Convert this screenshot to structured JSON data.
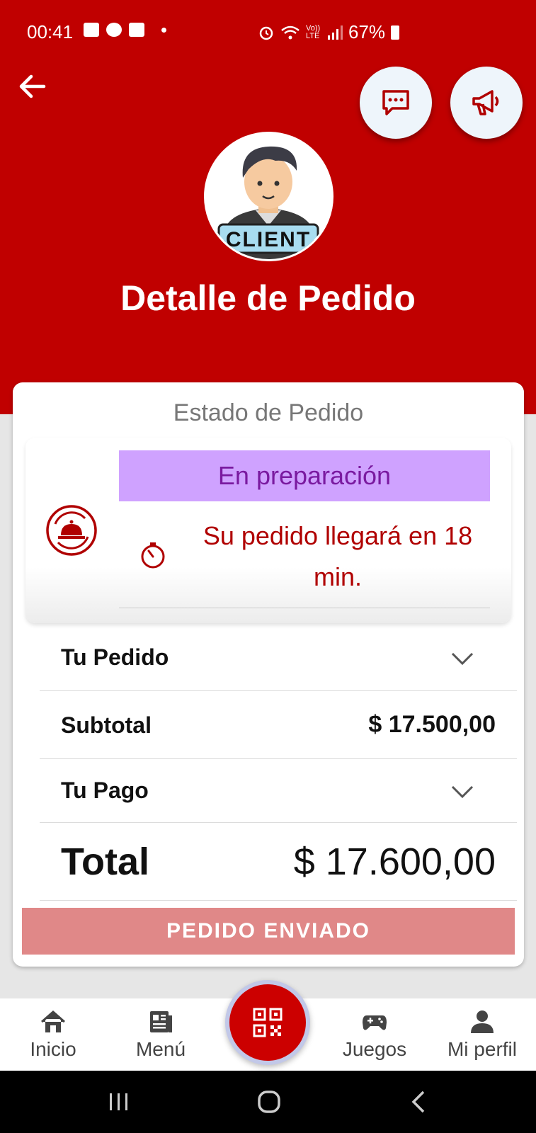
{
  "status_bar": {
    "time": "00:41",
    "battery": "67%",
    "signal_label": "Vo)) LTE"
  },
  "header": {
    "title": "Detalle de Pedido",
    "avatar_label": "CLIENT"
  },
  "status_section": {
    "label": "Estado de Pedido",
    "state": "En preparación",
    "eta_text": "Su pedido llegará en 18 min."
  },
  "summary": {
    "order_label": "Tu Pedido",
    "subtotal_label": "Subtotal",
    "subtotal_value": "$ 17.500,00",
    "payment_label": "Tu Pago",
    "total_label": "Total",
    "total_value": "$ 17.600,00"
  },
  "action": {
    "button_label": "PEDIDO ENVIADO"
  },
  "bottom_nav": {
    "items": [
      {
        "label": "Inicio",
        "icon": "home-icon"
      },
      {
        "label": "Menú",
        "icon": "menu-newspaper-icon"
      },
      {
        "label": "",
        "icon": "qr-code-icon"
      },
      {
        "label": "Juegos",
        "icon": "gamepad-icon"
      },
      {
        "label": "Mi perfil",
        "icon": "person-icon"
      }
    ]
  },
  "colors": {
    "brand_red": "#c00000",
    "status_pill_bg": "#cfa2ff",
    "status_pill_text": "#7a1aa0",
    "eta_text": "#b00000",
    "button_bg": "#e08888"
  }
}
